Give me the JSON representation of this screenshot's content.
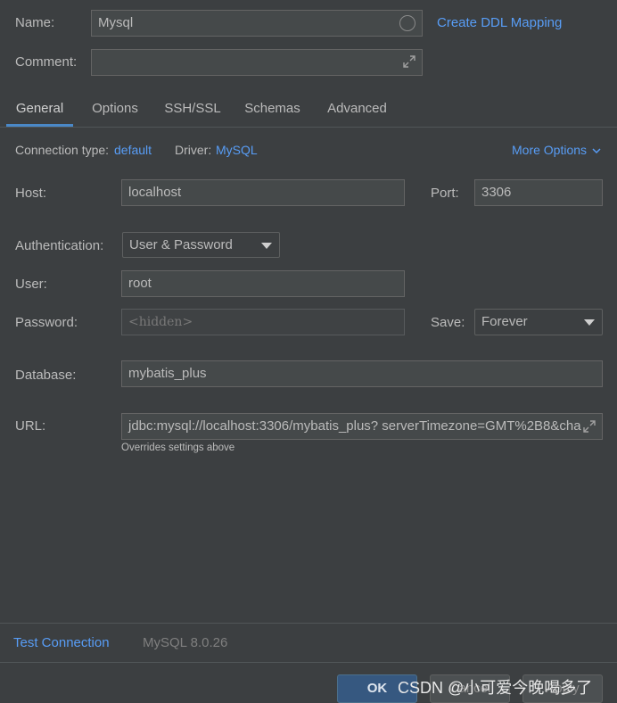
{
  "header": {
    "name_label": "Name:",
    "name_value": "Mysql",
    "create_ddl_link": "Create DDL Mapping",
    "comment_label": "Comment:",
    "comment_value": ""
  },
  "tabs": [
    {
      "label": "General",
      "active": true
    },
    {
      "label": "Options",
      "active": false
    },
    {
      "label": "SSH/SSL",
      "active": false
    },
    {
      "label": "Schemas",
      "active": false
    },
    {
      "label": "Advanced",
      "active": false
    }
  ],
  "connection": {
    "type_label": "Connection type:",
    "type_value": "default",
    "driver_label": "Driver:",
    "driver_value": "MySQL",
    "more_options": "More Options"
  },
  "form": {
    "host_label": "Host:",
    "host_value": "localhost",
    "port_label": "Port:",
    "port_value": "3306",
    "auth_label": "Authentication:",
    "auth_value": "User & Password",
    "user_label": "User:",
    "user_value": "root",
    "password_label": "Password:",
    "password_placeholder": "<hidden>",
    "save_label": "Save:",
    "save_value": "Forever",
    "database_label": "Database:",
    "database_value": "mybatis_plus",
    "url_label": "URL:",
    "url_value": "jdbc:mysql://localhost:3306/mybatis_plus? serverTimezone=GMT%2B8&cha",
    "url_hint": "Overrides settings above"
  },
  "footer": {
    "test_connection": "Test Connection",
    "driver_version": "MySQL 8.0.26",
    "ok_label": "OK",
    "cancel_label": "Cancel",
    "apply_label": "Apply"
  },
  "watermark": "CSDN @小可爱今晚喝多了",
  "colors": {
    "background": "#3c3f41",
    "link": "#589df6",
    "tab_underline": "#4a88c7",
    "primary_button": "#365880"
  }
}
